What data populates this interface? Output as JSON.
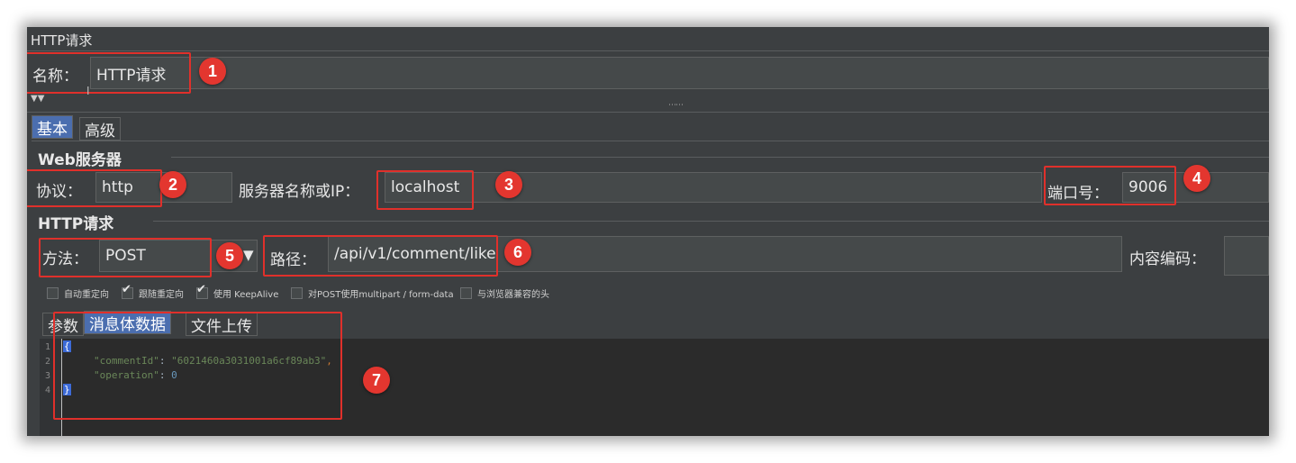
{
  "panel_title": "HTTP请求",
  "name": {
    "label": "名称：",
    "value": "HTTP请求"
  },
  "tabs": [
    {
      "label": "基本"
    },
    {
      "label": "高级"
    }
  ],
  "web_server": {
    "section_title": "Web服务器",
    "protocol_label": "协议：",
    "protocol_value": "http",
    "server_label": "服务器名称或IP：",
    "server_value": "localhost",
    "port_label": "端口号：",
    "port_value": "9006"
  },
  "http_request": {
    "section_title": "HTTP请求",
    "method_label": "方法：",
    "method_value": "POST",
    "path_label": "路径：",
    "path_value": "/api/v1/comment/like",
    "encoding_label": "内容编码："
  },
  "options": [
    {
      "label": "自动重定向",
      "checked": false
    },
    {
      "label": "跟随重定向",
      "checked": true
    },
    {
      "label": "使用 KeepAlive",
      "checked": true
    },
    {
      "label": "对POST使用multipart / form-data",
      "checked": false
    },
    {
      "label": "与浏览器兼容的头",
      "checked": false
    }
  ],
  "body_tabs": [
    {
      "label": "参数"
    },
    {
      "label": "消息体数据"
    },
    {
      "label": "文件上传"
    }
  ],
  "editor": {
    "line_numbers": [
      "1",
      "2",
      "3",
      "4"
    ],
    "open_brace": "{",
    "close_brace": "}",
    "key1": "\"commentId\"",
    "val1": "\"6021460a3031001a6cf89ab3\"",
    "key2": "\"operation\"",
    "val2": "0",
    "colon": ": ",
    "comma": ","
  },
  "markers": [
    "1",
    "2",
    "3",
    "4",
    "5",
    "6",
    "7"
  ],
  "colors": {
    "annotation_red": "#e0302b",
    "selected_tab": "#4b6eaf",
    "panel_bg": "#3c3f41"
  }
}
